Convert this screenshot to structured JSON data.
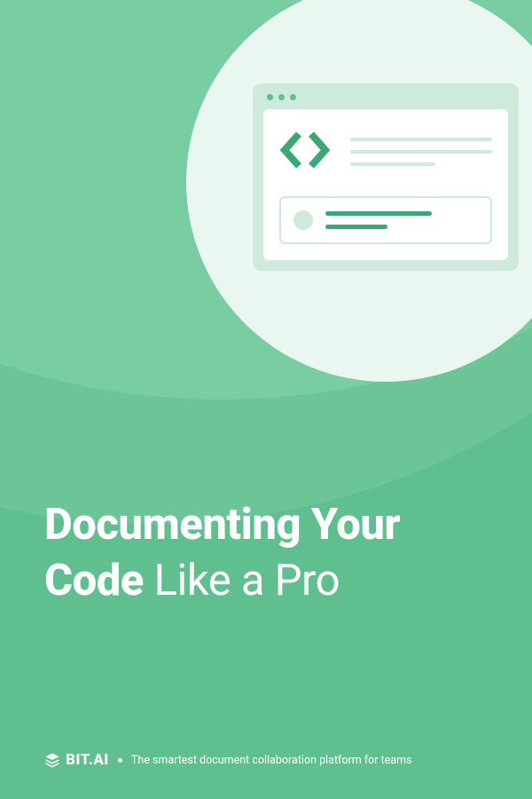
{
  "headline": {
    "bold": "Documenting Your Code",
    "light": " Like a Pro"
  },
  "footer": {
    "brand": "BIT.AI",
    "tagline": "The smartest document collaboration platform for teams"
  }
}
